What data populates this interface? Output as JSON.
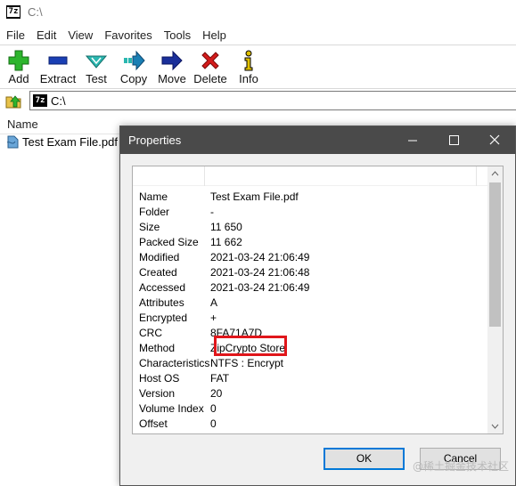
{
  "window": {
    "title": "C:\\",
    "app_icon_text": "7z"
  },
  "menu": [
    "File",
    "Edit",
    "View",
    "Favorites",
    "Tools",
    "Help"
  ],
  "toolbar": [
    {
      "label": "Add",
      "icon": "plus-icon",
      "color": "#2db52d"
    },
    {
      "label": "Extract",
      "icon": "minus-icon",
      "color": "#1a3fb4"
    },
    {
      "label": "Test",
      "icon": "check-icon",
      "color": "#2ab7b0"
    },
    {
      "label": "Copy",
      "icon": "copy-arrow-icon",
      "color": "#1a7fb4"
    },
    {
      "label": "Move",
      "icon": "move-arrow-icon",
      "color": "#1a2f9a"
    },
    {
      "label": "Delete",
      "icon": "delete-x-icon",
      "color": "#d41b1b"
    },
    {
      "label": "Info",
      "icon": "info-icon",
      "color": "#e0c000"
    }
  ],
  "address": {
    "value": "C:\\"
  },
  "file_list": {
    "column_name": "Name",
    "items": [
      "Test Exam File.pdf"
    ]
  },
  "dialog": {
    "title": "Properties",
    "rows": [
      {
        "name": "Name",
        "value": "Test Exam File.pdf"
      },
      {
        "name": "Folder",
        "value": "-"
      },
      {
        "name": "Size",
        "value": "11 650"
      },
      {
        "name": "Packed Size",
        "value": "11 662"
      },
      {
        "name": "Modified",
        "value": "2021-03-24 21:06:49"
      },
      {
        "name": "Created",
        "value": "2021-03-24 21:06:48"
      },
      {
        "name": "Accessed",
        "value": "2021-03-24 21:06:49"
      },
      {
        "name": "Attributes",
        "value": "A"
      },
      {
        "name": "Encrypted",
        "value": "+"
      },
      {
        "name": "CRC",
        "value": "8FA71A7D"
      },
      {
        "name": "Method",
        "value": "ZipCrypto Store"
      },
      {
        "name": "Characteristics",
        "value": "NTFS : Encrypt"
      },
      {
        "name": "Host OS",
        "value": "FAT"
      },
      {
        "name": "Version",
        "value": "20"
      },
      {
        "name": "Volume Index",
        "value": "0"
      },
      {
        "name": "Offset",
        "value": "0"
      }
    ],
    "ok_label": "OK",
    "cancel_label": "Cancel",
    "highlight_color": "#e0161b"
  },
  "watermark": "@稀土掘金技术社区"
}
